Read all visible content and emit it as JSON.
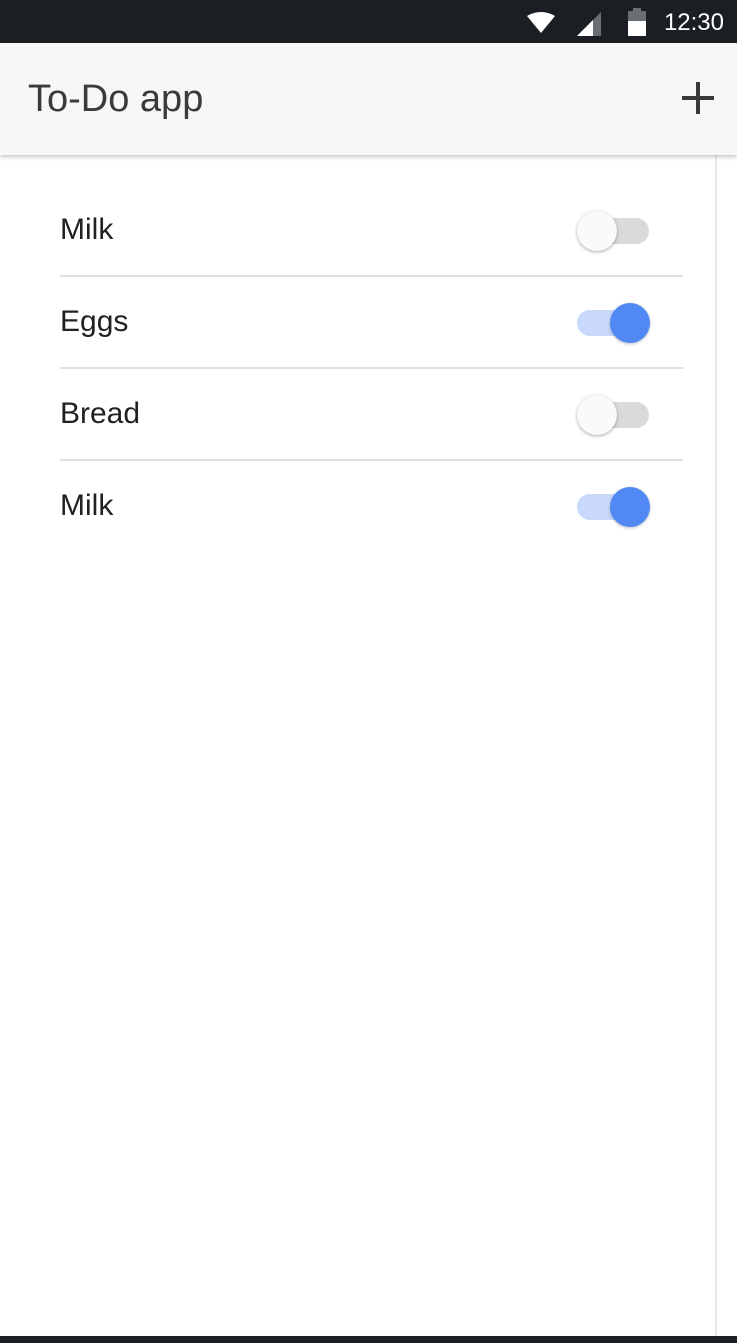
{
  "status_bar": {
    "time": "12:30",
    "icons": [
      "wifi-icon",
      "signal-icon",
      "battery-icon"
    ]
  },
  "app_bar": {
    "title": "To-Do app",
    "add_icon": "plus-icon"
  },
  "todos": [
    {
      "label": "Milk",
      "done": false
    },
    {
      "label": "Eggs",
      "done": true
    },
    {
      "label": "Bread",
      "done": false
    },
    {
      "label": "Milk",
      "done": true
    }
  ],
  "colors": {
    "accent": "#5089f3",
    "accent_track": "#c8d9fb",
    "status_bar": "#1b1e22",
    "app_bar": "#f7f7f7"
  }
}
